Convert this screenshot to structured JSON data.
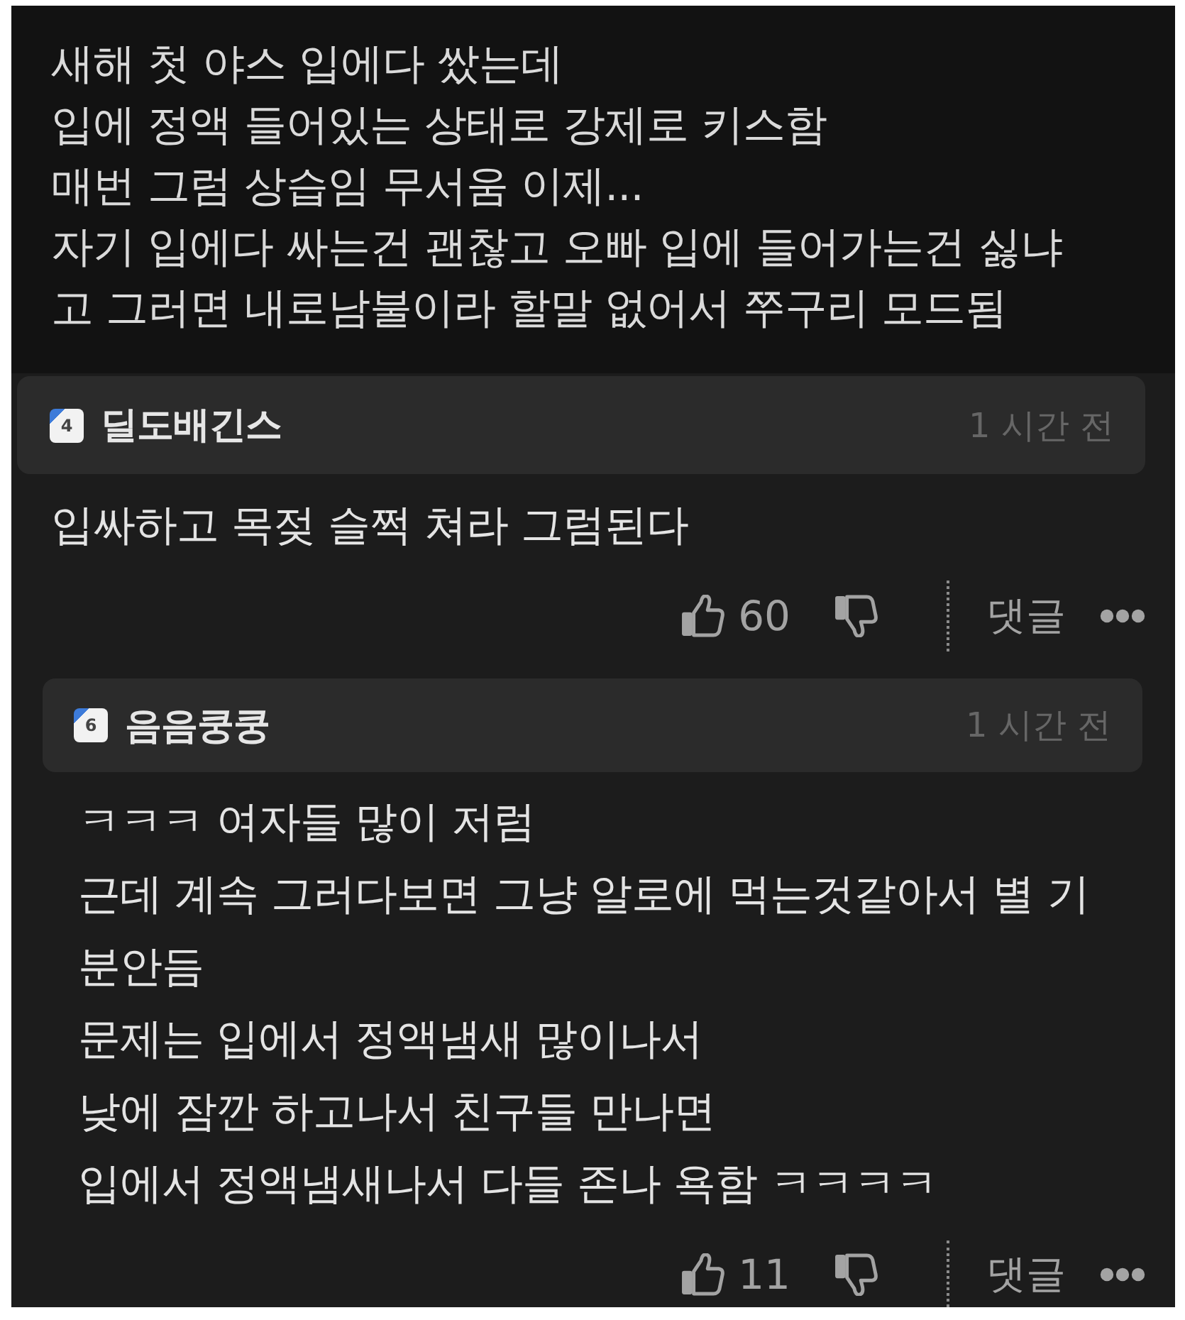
{
  "post": {
    "lines": [
      "새해 첫 야스 입에다 쌌는데",
      "입에 정액 들어있는 상태로 강제로 키스함",
      "매번 그럼 상습임 무서움 이제...",
      "자기 입에다 싸는건 괜찮고 오빠 입에 들어가는건 싫냐",
      "고 그러면 내로남불이라 할말 없어서 쭈구리 모드됨"
    ]
  },
  "comments": [
    {
      "author": {
        "badge": "4",
        "name": "딜도배긴스"
      },
      "time": "1 시간 전",
      "lines": [
        "입싸하고 목젖 슬쩍 쳐라 그럼된다"
      ],
      "likes": "60",
      "reply_label": "댓글",
      "replies": [
        {
          "author": {
            "badge": "6",
            "name": "음음쿵쿵"
          },
          "time": "1 시간 전",
          "lines": [
            "ㅋㅋㅋ 여자들 많이 저럼",
            "근데 계속 그러다보면 그냥 알로에 먹는것같아서 별 기",
            "분안듬",
            "문제는 입에서 정액냄새 많이나서",
            "낮에 잠깐 하고나서 친구들 만나면",
            "입에서 정액냄새나서 다들 존나 욕함 ㅋㅋㅋㅋ"
          ],
          "likes": "11",
          "reply_label": "댓글"
        }
      ]
    }
  ]
}
